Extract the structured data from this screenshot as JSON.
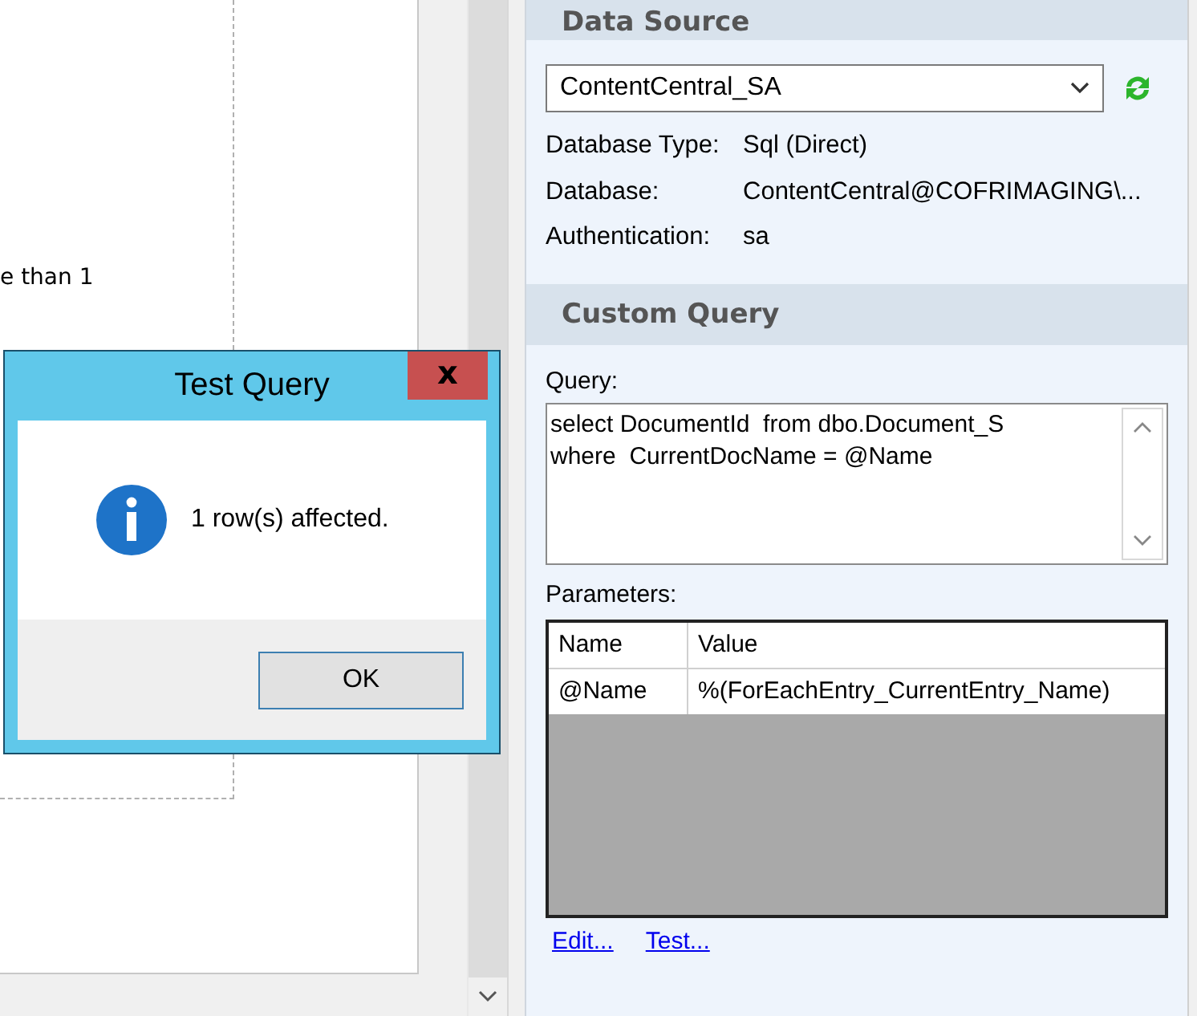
{
  "canvas": {
    "text": "e than 1"
  },
  "data_source": {
    "title": "Data Source",
    "connection": "ContentCentral_SA",
    "properties": [
      {
        "label": "Database Type:",
        "value": "Sql (Direct)"
      },
      {
        "label": "Database:",
        "value": "ContentCentral@COFRIMAGING\\..."
      },
      {
        "label": "Authentication:",
        "value": "sa"
      }
    ]
  },
  "custom_query": {
    "title": "Custom Query",
    "query_label": "Query:",
    "query": "select DocumentId  from dbo.Document_S\nwhere  CurrentDocName = @Name",
    "parameters_label": "Parameters:",
    "parameters": {
      "columns": [
        "Name",
        "Value"
      ],
      "rows": [
        [
          "@Name",
          "%(ForEachEntry_CurrentEntry_Name)"
        ]
      ]
    },
    "links": [
      "Edit...",
      "Test..."
    ]
  },
  "dialog": {
    "title": "Test Query",
    "close": "x",
    "message": "1 row(s) affected.",
    "button": "OK"
  }
}
